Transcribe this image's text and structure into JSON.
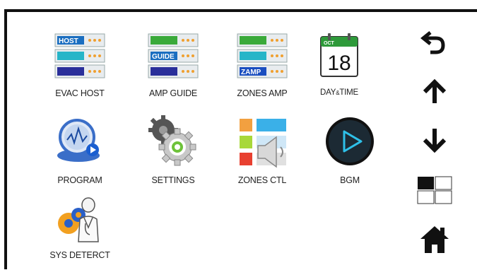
{
  "tiles": [
    {
      "label": "EVAC HOST",
      "icon": "rack-host-icon"
    },
    {
      "label": "AMP GUIDE",
      "icon": "rack-guide-icon"
    },
    {
      "label": "ZONES AMP",
      "icon": "rack-zamp-icon"
    },
    {
      "label": "DAY",
      "label_sep": "&",
      "label_end": "TIME",
      "icon": "calendar-icon"
    },
    {
      "label": "PROGRAM",
      "icon": "program-icon"
    },
    {
      "label": "SETTINGS",
      "icon": "gears-icon"
    },
    {
      "label": "ZONES CTL",
      "icon": "zones-speaker-icon"
    },
    {
      "label": "BGM",
      "icon": "play-icon"
    },
    {
      "label": "SYS DETERCT",
      "icon": "diagnostic-icon"
    }
  ],
  "rack_texts": {
    "host": "HOST",
    "guide": "GUIDE",
    "zamp": "ZAMP"
  },
  "calendar": {
    "month": "OCT",
    "day": "18"
  },
  "side": {
    "back": "back-arrow-icon",
    "up": "up-arrow-icon",
    "down": "down-arrow-icon",
    "layout": "layout-grid-icon",
    "home": "home-icon"
  }
}
